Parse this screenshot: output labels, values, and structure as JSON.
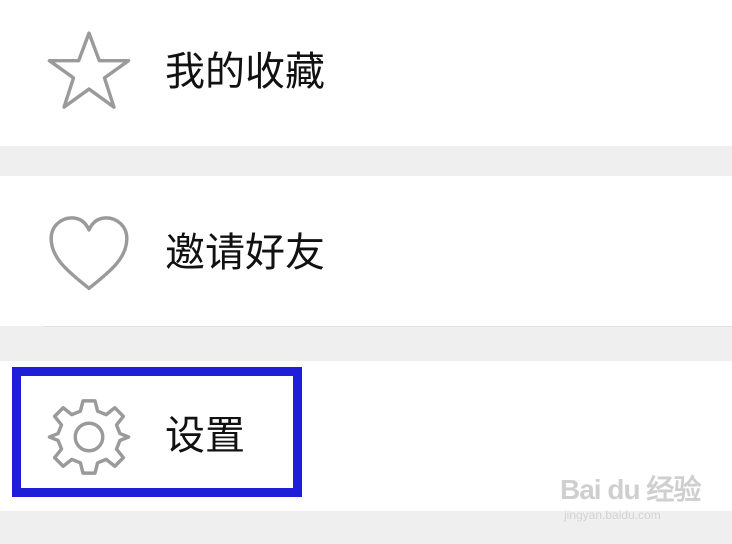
{
  "menu": {
    "items": [
      {
        "label": "我的收藏",
        "icon": "star-icon"
      },
      {
        "label": "邀请好友",
        "icon": "heart-icon"
      },
      {
        "label": "设置",
        "icon": "gear-icon"
      }
    ]
  },
  "highlight": {
    "color": "#1f1fd8"
  },
  "watermark": {
    "main": "Bai du 经验",
    "sub": "jingyan.baidu.com"
  },
  "colors": {
    "background": "#efefef",
    "row": "#ffffff",
    "icon_stroke": "#9a9a9a",
    "text": "#111111"
  }
}
